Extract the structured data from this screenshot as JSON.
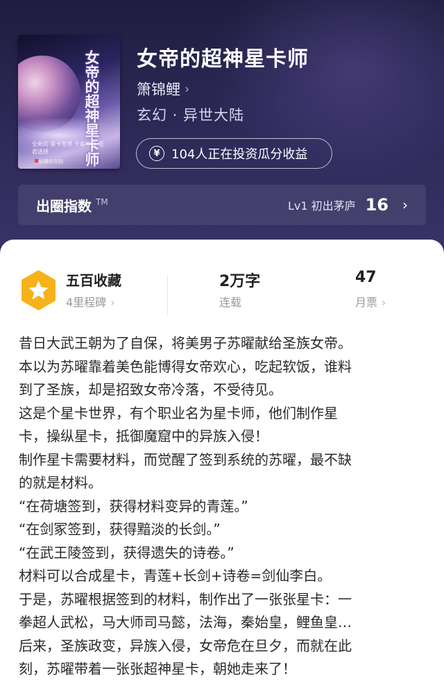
{
  "book": {
    "title": "女帝的超神星卡师",
    "author": "箫锦鲤",
    "genre": "玄幻 · 异世大陆",
    "invest_text": "104人正在投资瓜分收益",
    "cover": {
      "title": "女帝的超神星卡师",
      "small_text": "全新的 星卡世界 千般神兵 任君选择",
      "publisher": "纵横中文网",
      "author_tag": "箫锦鲤"
    }
  },
  "popularity": {
    "title": "出圈指数",
    "tm": "TM",
    "level": "Lv1 初出茅庐",
    "score": "16"
  },
  "stats": {
    "milestone_title": "五百收藏",
    "milestone_sub": "4里程碑",
    "words_value": "2万字",
    "words_label": "连载",
    "votes_value": "47",
    "votes_label": "月票"
  },
  "synopsis": [
    "昔日大武王朝为了自保，将美男子苏曜献给圣族女帝。",
    "本以为苏曜靠着美色能博得女帝欢心，吃起软饭，谁料",
    "到了圣族，却是招致女帝冷落，不受待见。",
    "这是个星卡世界，有个职业名为星卡师，他们制作星",
    "卡，操纵星卡，抵御魔窟中的异族入侵！",
    "制作星卡需要材料，而觉醒了签到系统的苏曜，最不缺",
    "的就是材料。",
    "“在荷塘签到，获得材料变异的青莲。”",
    "“在剑冢签到，获得黯淡的长剑。”",
    "“在武王陵签到，获得遗失的诗卷。”",
    "材料可以合成星卡，青莲+长剑+诗卷=剑仙李白。",
    "于是，苏曜根据签到的材料，制作出了一张张星卡：一",
    "拳超人武松，马大师司马懿，法海，秦始皇，鲤鱼皇…",
    "后来，圣族政变，异族入侵，女帝危在旦夕，而就在此",
    "刻，苏曜带着一张张超神星卡，朝她走来了！"
  ],
  "colors": {
    "header_bg": "#2c2856",
    "badge": "#f6b21a"
  }
}
